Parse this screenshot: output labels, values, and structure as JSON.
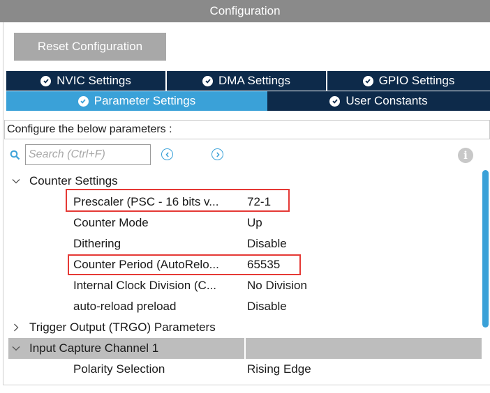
{
  "window": {
    "title": "Configuration"
  },
  "toolbar": {
    "reset_label": "Reset Configuration"
  },
  "tabs_top": [
    {
      "label": "NVIC Settings"
    },
    {
      "label": "DMA Settings"
    },
    {
      "label": "GPIO Settings"
    }
  ],
  "tabs_bottom": [
    {
      "label": "Parameter Settings",
      "active": true
    },
    {
      "label": "User Constants",
      "active": false
    }
  ],
  "description": "Configure the below parameters :",
  "search": {
    "placeholder": "Search (Ctrl+F)"
  },
  "groups": {
    "counter": {
      "label": "Counter Settings",
      "expanded": true
    },
    "trgo": {
      "label": "Trigger Output (TRGO) Parameters",
      "expanded": false
    },
    "input_capture": {
      "label": "Input Capture Channel 1",
      "expanded": true
    }
  },
  "params": [
    {
      "label": "Prescaler (PSC - 16 bits v...",
      "value": "72-1",
      "highlighted": true
    },
    {
      "label": "Counter Mode",
      "value": "Up"
    },
    {
      "label": "Dithering",
      "value": "Disable"
    },
    {
      "label": "Counter Period (AutoRelo...",
      "value": "65535",
      "highlighted": true
    },
    {
      "label": "Internal Clock Division (C...",
      "value": "No Division"
    },
    {
      "label": "auto-reload preload",
      "value": "Disable"
    }
  ],
  "capture_params": [
    {
      "label": "Polarity Selection",
      "value": "Rising Edge"
    }
  ],
  "colors": {
    "tab_dark": "#0d2a4a",
    "tab_active": "#3aa1d8",
    "highlight": "#e53935"
  }
}
